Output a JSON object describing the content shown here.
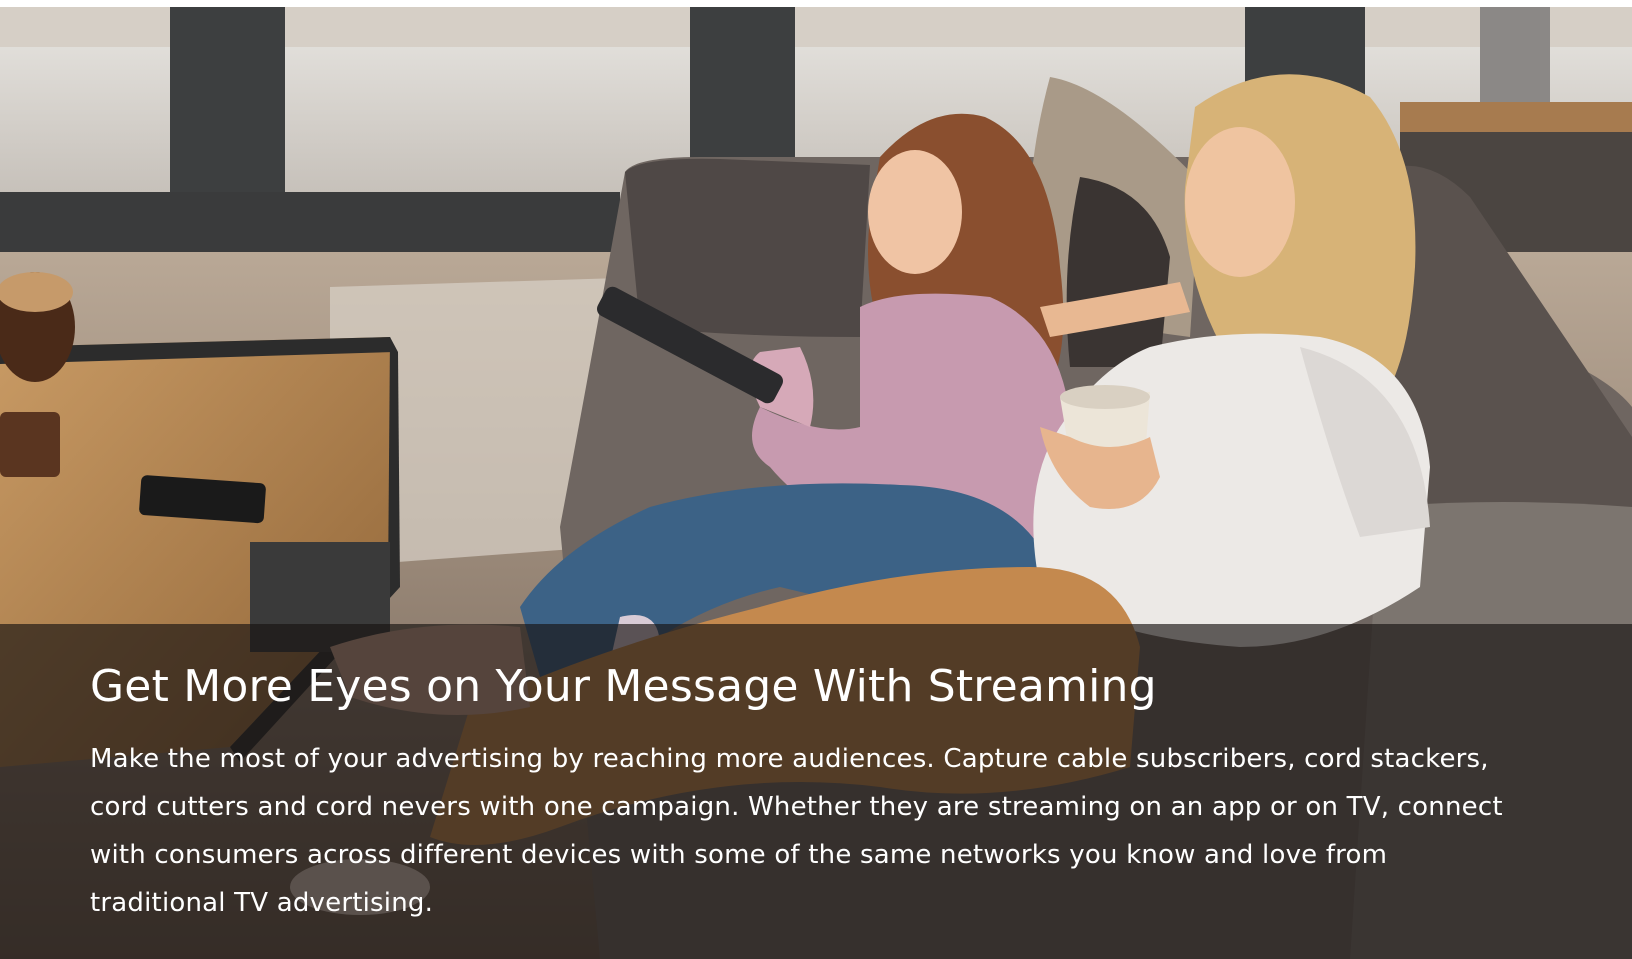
{
  "hero": {
    "image_alt": "Mother and daughter relaxing on a couch, daughter holding a TV remote, mother holding a mug",
    "headline": "Get More Eyes on Your Message With Streaming",
    "body": "Make the most of your advertising by reaching more audiences. Capture cable subscribers, cord stackers, cord cutters and cord nevers with one campaign. Whether they are streaming on an app or on TV, connect with consumers across different devices with some of the same networks you know and love from traditional TV advertising."
  },
  "colors": {
    "overlay": "#181412",
    "text": "#ffffff"
  }
}
